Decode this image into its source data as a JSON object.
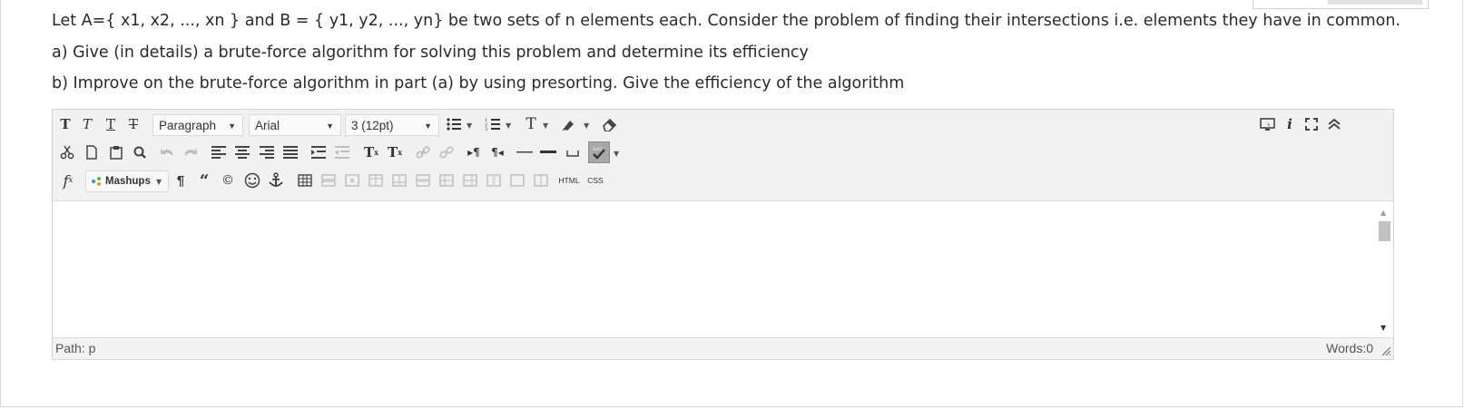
{
  "question": {
    "line1": "Let A={ x1, x2, ..., xn } and B = { y1, y2, ..., yn} be two sets of n elements each. Consider the problem of finding their intersections i.e. elements they have in common.",
    "line2": "a) Give (in details)  a brute-force algorithm for solving this problem and determine its efficiency",
    "line3": "b) Improve on the brute-force algorithm in part (a) by using presorting. Give the efficiency of the algorithm"
  },
  "toolbar": {
    "format_select": "Paragraph",
    "font_select": "Arial",
    "size_select": "3 (12pt)",
    "mashups_label": "Mashups",
    "html_label": "HTML",
    "css_label": "CSS",
    "icons": [
      "bold-icon",
      "italic-icon",
      "underline-icon",
      "strikethrough-icon",
      "bullet-list-icon",
      "numbered-list-icon",
      "text-color-icon",
      "highlight-icon",
      "eraser-icon",
      "cut-icon",
      "copy-icon",
      "paste-icon",
      "find-icon",
      "undo-icon",
      "redo-icon",
      "align-left-icon",
      "align-center-icon",
      "align-right-icon",
      "align-justify-icon",
      "indent-icon",
      "outdent-icon",
      "superscript-icon",
      "subscript-icon",
      "link-icon",
      "unlink-icon",
      "ltr-icon",
      "rtl-icon",
      "horizontal-rule-icon",
      "nonbreaking-space-icon",
      "spellcheck-icon",
      "formula-icon",
      "paragraph-mark-icon",
      "blockquote-icon",
      "copyright-icon",
      "emoticon-icon",
      "anchor-icon",
      "table-icon",
      "preview-icon",
      "info-icon",
      "fullscreen-icon",
      "collapse-icon"
    ]
  },
  "status": {
    "path": "Path: p",
    "words": "Words:0"
  }
}
